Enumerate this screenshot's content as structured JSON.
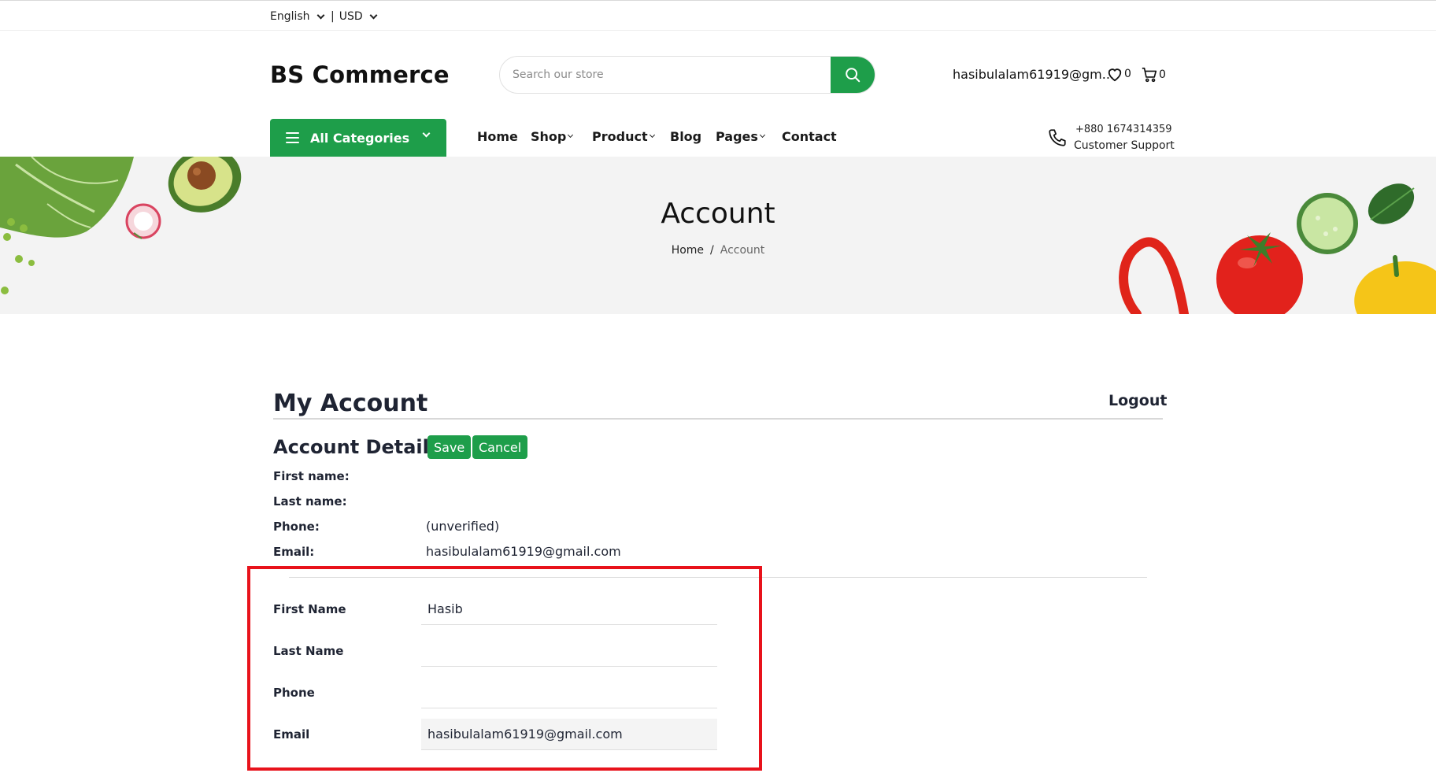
{
  "topbar": {
    "language": "English",
    "separator": "|",
    "currency": "USD"
  },
  "header": {
    "logo": "BS Commerce",
    "search_placeholder": "Search our store",
    "account_email": "hasibulalam61919@gm...",
    "wishlist_count": "0",
    "cart_count": "0"
  },
  "nav": {
    "all_categories": "All Categories",
    "items": [
      {
        "label": "Home"
      },
      {
        "label": "Shop"
      },
      {
        "label": "Product"
      },
      {
        "label": "Blog"
      },
      {
        "label": "Pages"
      },
      {
        "label": "Contact"
      }
    ],
    "support_phone": "+880 1674314359",
    "support_label": "Customer Support"
  },
  "banner": {
    "title": "Account",
    "breadcrumb_home": "Home",
    "breadcrumb_sep": "/",
    "breadcrumb_current": "Account"
  },
  "account": {
    "title": "My Account",
    "logout": "Logout",
    "details_title": "Account Details",
    "save_label": "Save",
    "cancel_label": "Cancel",
    "info": {
      "first_name_label": "First name:",
      "first_name_value": "",
      "last_name_label": "Last name:",
      "last_name_value": "",
      "phone_label": "Phone:",
      "phone_value": "(unverified)",
      "email_label": "Email:",
      "email_value": "hasibulalam61919@gmail.com"
    },
    "form": {
      "first_name_label": "First Name",
      "first_name_value": "Hasib",
      "last_name_label": "Last Name",
      "last_name_value": "",
      "phone_label": "Phone",
      "phone_value": "",
      "email_label": "Email",
      "email_value": "hasibulalam61919@gmail.com"
    }
  },
  "colors": {
    "brand_green": "#1e9e4a",
    "highlight_red": "#e8121b",
    "banner_bg": "#f3f3f3"
  }
}
